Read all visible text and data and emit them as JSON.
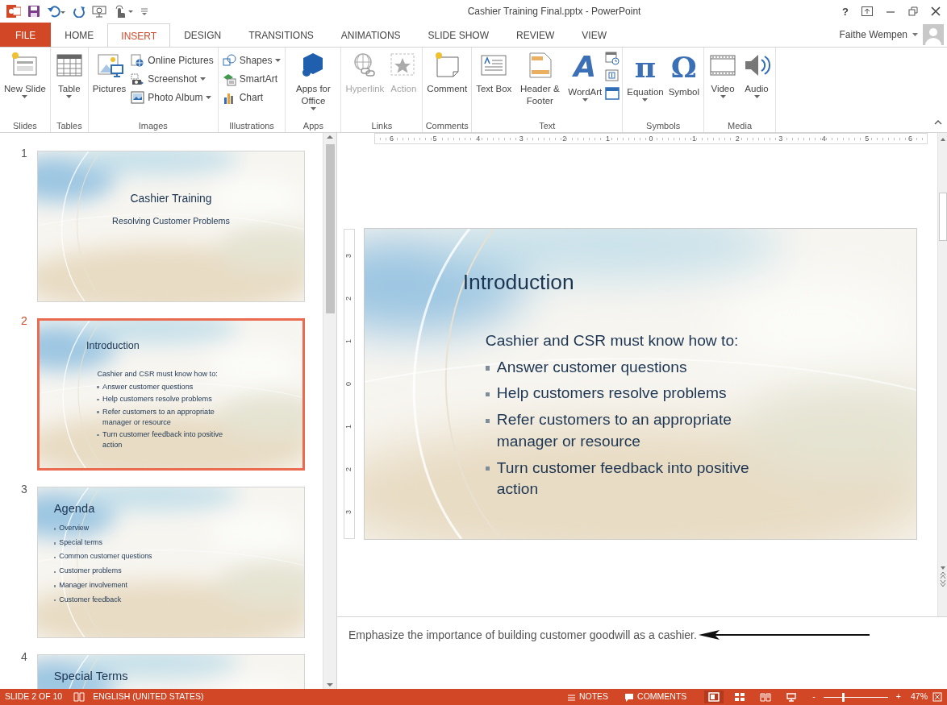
{
  "window": {
    "title": "Cashier Training Final.pptx - PowerPoint",
    "help": "?"
  },
  "tabs": [
    {
      "label": "FILE",
      "kind": "file",
      "selected": false
    },
    {
      "label": "HOME",
      "kind": "tab",
      "selected": false
    },
    {
      "label": "INSERT",
      "kind": "tab",
      "selected": true
    },
    {
      "label": "DESIGN",
      "kind": "tab",
      "selected": false
    },
    {
      "label": "TRANSITIONS",
      "kind": "tab",
      "selected": false
    },
    {
      "label": "ANIMATIONS",
      "kind": "tab",
      "selected": false
    },
    {
      "label": "SLIDE SHOW",
      "kind": "tab",
      "selected": false
    },
    {
      "label": "REVIEW",
      "kind": "tab",
      "selected": false
    },
    {
      "label": "VIEW",
      "kind": "tab",
      "selected": false
    }
  ],
  "user": {
    "name": "Faithe Wempen"
  },
  "ribbon": {
    "groups": [
      {
        "label": "Slides",
        "items": [
          {
            "kind": "large",
            "label": "New Slide",
            "dropdown": true,
            "disabled": false
          }
        ]
      },
      {
        "label": "Tables",
        "items": [
          {
            "kind": "large",
            "label": "Table",
            "dropdown": true,
            "disabled": false
          }
        ]
      },
      {
        "label": "Images",
        "items": [
          {
            "kind": "large",
            "label": "Pictures",
            "dropdown": false,
            "disabled": false
          },
          {
            "kind": "stack",
            "buttons": [
              {
                "label": "Online Pictures",
                "dropdown": false
              },
              {
                "label": "Screenshot",
                "dropdown": true
              },
              {
                "label": "Photo Album",
                "dropdown": true
              }
            ]
          }
        ]
      },
      {
        "label": "Illustrations",
        "items": [
          {
            "kind": "stack",
            "buttons": [
              {
                "label": "Shapes",
                "dropdown": true
              },
              {
                "label": "SmartArt",
                "dropdown": false
              },
              {
                "label": "Chart",
                "dropdown": false
              }
            ]
          }
        ]
      },
      {
        "label": "Apps",
        "items": [
          {
            "kind": "large",
            "label": "Apps for Office",
            "dropdown": true,
            "disabled": false
          }
        ]
      },
      {
        "label": "Links",
        "items": [
          {
            "kind": "large",
            "label": "Hyperlink",
            "dropdown": false,
            "disabled": true
          },
          {
            "kind": "large",
            "label": "Action",
            "dropdown": false,
            "disabled": true
          }
        ]
      },
      {
        "label": "Comments",
        "items": [
          {
            "kind": "large",
            "label": "Comment",
            "dropdown": false,
            "disabled": false
          }
        ]
      },
      {
        "label": "Text",
        "items": [
          {
            "kind": "large",
            "label": "Text Box",
            "dropdown": false,
            "disabled": false
          },
          {
            "kind": "large",
            "label": "Header & Footer",
            "dropdown": false,
            "disabled": false
          },
          {
            "kind": "large",
            "label": "WordArt",
            "glyph": "A",
            "dropdown": true,
            "disabled": false
          },
          {
            "kind": "icons"
          }
        ]
      },
      {
        "label": "Symbols",
        "items": [
          {
            "kind": "large",
            "label": "Equation",
            "glyph": "π",
            "dropdown": true,
            "disabled": false
          },
          {
            "kind": "large",
            "label": "Symbol",
            "glyph": "Ω",
            "dropdown": false,
            "disabled": false
          }
        ]
      },
      {
        "label": "Media",
        "items": [
          {
            "kind": "large",
            "label": "Video",
            "dropdown": true,
            "disabled": false
          },
          {
            "kind": "large",
            "label": "Audio",
            "dropdown": true,
            "disabled": false
          }
        ]
      }
    ]
  },
  "slides_panel": {
    "slides": [
      {
        "number": "1",
        "kind": "title",
        "selected": false,
        "title": "Cashier Training",
        "subtitle": "Resolving Customer Problems"
      },
      {
        "number": "2",
        "kind": "content",
        "selected": true,
        "title": "Introduction",
        "intro": "Cashier and CSR must know how to:",
        "bullets": [
          "Answer customer questions",
          "Help customers resolve problems",
          "Refer customers to an appropriate manager or resource",
          "Turn customer feedback into positive action"
        ]
      },
      {
        "number": "3",
        "kind": "list",
        "selected": false,
        "title": "Agenda",
        "bullets": [
          "Overview",
          "Special terms",
          "Common customer questions",
          "Customer problems",
          "Manager involvement",
          "Customer feedback"
        ]
      },
      {
        "number": "4",
        "kind": "list",
        "selected": false,
        "title": "Special Terms"
      }
    ]
  },
  "ruler": {
    "horizontal": [
      "6",
      "5",
      "4",
      "3",
      "2",
      "1",
      "0",
      "1",
      "2",
      "3",
      "4",
      "5",
      "6"
    ],
    "vertical": [
      "3",
      "2",
      "1",
      "0",
      "1",
      "2",
      "3"
    ]
  },
  "editor": {
    "slide": {
      "kind": "content",
      "title": "Introduction",
      "intro": "Cashier and CSR must know how to:",
      "bullets": [
        "Answer customer questions",
        "Help customers resolve problems",
        "Refer customers to an appropriate manager or resource",
        "Turn customer feedback into positive action"
      ]
    }
  },
  "notes": {
    "text": "Emphasize the importance of building customer goodwill as a cashier."
  },
  "status_bar": {
    "slide": "SLIDE 2 OF 10",
    "language": "ENGLISH (UNITED STATES)",
    "notes": "NOTES",
    "comments": "COMMENTS",
    "views": [
      {
        "selected": true
      },
      {
        "selected": false
      },
      {
        "selected": false
      },
      {
        "selected": false
      }
    ],
    "zoom_out": "-",
    "zoom_in": "+",
    "zoom": {
      "level": 0.3
    },
    "zoom_label": "47%"
  }
}
